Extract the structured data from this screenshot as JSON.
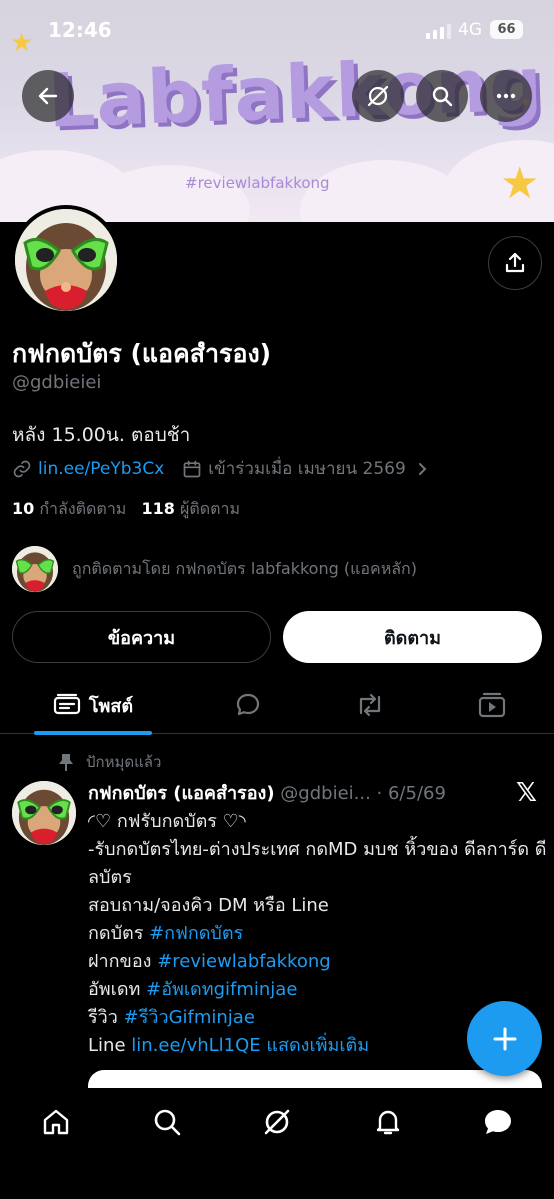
{
  "status_bar": {
    "time": "12:46",
    "network": "4G",
    "battery": "66"
  },
  "banner": {
    "title": "Labfakkong",
    "hashtag": "#reviewlabfakkong"
  },
  "profile": {
    "name": "กฟกดบัตร (แอคสำรอง)",
    "handle": "@gdbieiei",
    "bio": "หลัง 15.00น. ตอบช้า",
    "link": "lin.ee/PeYb3Cx",
    "joined": "เข้าร่วมเมื่อ เมษายน 2569",
    "following_count": "10",
    "following_label": "กำลังติดตาม",
    "followers_count": "118",
    "followers_label": "ผู้ติดตาม",
    "followed_by": "ถูกติดตามโดย กฟกดบัตร labfakkong (แอคหลัก)"
  },
  "actions": {
    "message": "ข้อความ",
    "follow": "ติดตาม"
  },
  "tabs": {
    "posts": "โพสต์"
  },
  "post": {
    "pinned_label": "ปักหมุดแล้ว",
    "author": "กฟกดบัตร (แอคสำรอง)",
    "meta": "@gdbiei... · 6/5/69",
    "line1": "◜♡ กฟรับกดบัตร ♡◝",
    "line2": "-รับกดบัตรไทย-ต่างประเทศ กดMD มบช หิ้วของ ดีลการ์ด ดีลบัตร",
    "line3": "สอบถาม/จองคิว DM หรือ Line",
    "line4_prefix": "กดบัตร ",
    "line4_tag": "#กฟกดบัตร",
    "line5_prefix": "ฝากของ ",
    "line5_tag": "#reviewlabfakkong",
    "line6_prefix": "อัพเดท ",
    "line6_tag": "#อัพเดทgifminjae",
    "line7_prefix": "รีวิว ",
    "line7_tag": "#รีวิวGifminjae",
    "line8_prefix": "Line ",
    "line8_link": "lin.ee/vhLl1QE",
    "show_more": "แสดงเพิ่มเติม"
  },
  "colors": {
    "accent": "#1d9bf0",
    "background": "#000000",
    "muted": "#71767b"
  }
}
